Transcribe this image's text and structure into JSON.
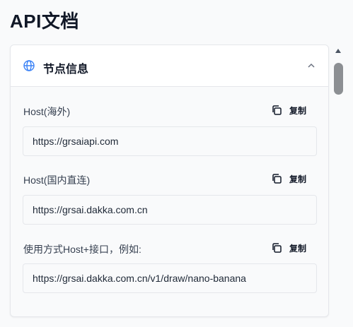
{
  "page": {
    "title": "API文档"
  },
  "section": {
    "title": "节点信息"
  },
  "rows": [
    {
      "label": "Host(海外)",
      "copy_label": "复制",
      "value": "https://grsaiapi.com"
    },
    {
      "label": "Host(国内直连)",
      "copy_label": "复制",
      "value": "https://grsai.dakka.com.cn"
    },
    {
      "label": "使用方式Host+接口，例如:",
      "copy_label": "复制",
      "value": "https://grsai.dakka.com.cn/v1/draw/nano-banana"
    }
  ],
  "colors": {
    "accent": "#3b82f6",
    "border": "#e5e7eb",
    "text": "#1f2937"
  }
}
